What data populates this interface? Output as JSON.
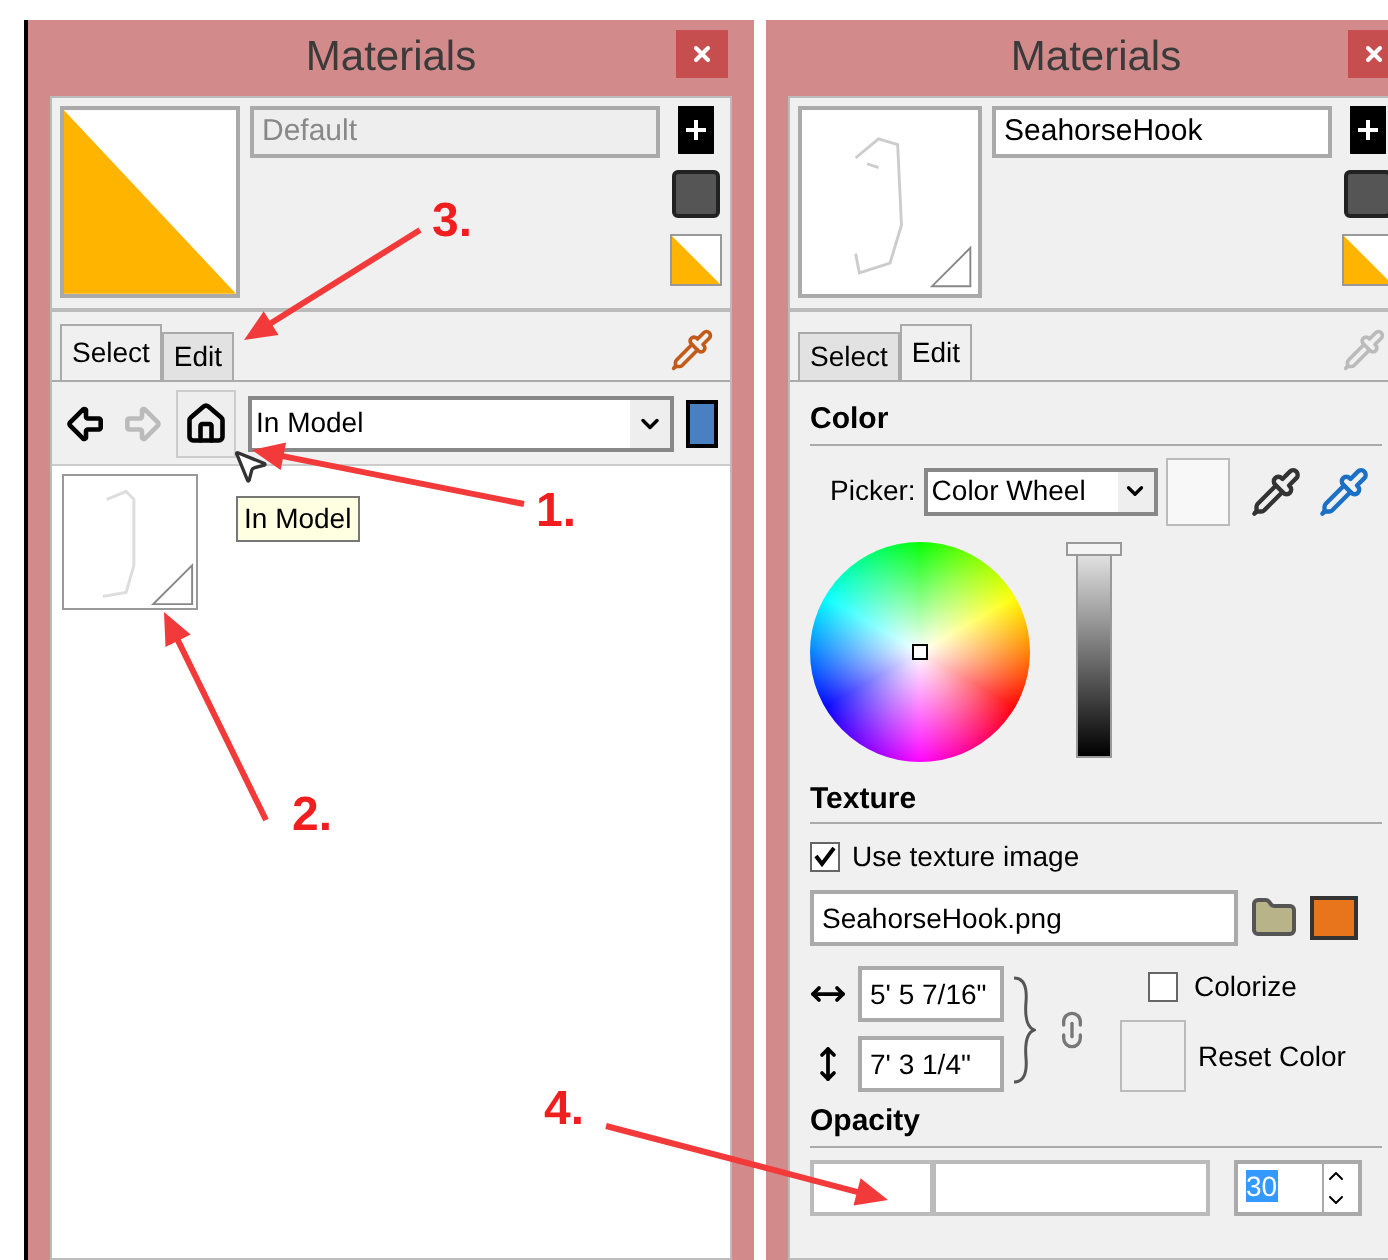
{
  "panels": [
    {
      "title": "Materials",
      "swatch": {
        "kind": "color",
        "color": "#ffb400"
      },
      "name": {
        "value": "Default",
        "disabled": true
      },
      "tabs": [
        {
          "label": "Select",
          "selected": true
        },
        {
          "label": "Edit",
          "selected": false
        }
      ],
      "eyedropper_enabled": true,
      "content": {
        "kind": "library",
        "collection": "In Model",
        "tooltip": "In Model"
      }
    },
    {
      "title": "Materials",
      "swatch": {
        "kind": "texture"
      },
      "name": {
        "value": "SeahorseHook",
        "disabled": false
      },
      "tabs": [
        {
          "label": "Select",
          "selected": false
        },
        {
          "label": "Edit",
          "selected": true
        }
      ],
      "eyedropper_enabled": false,
      "content": {
        "kind": "editor",
        "color": {
          "heading": "Color",
          "picker_label": "Picker:",
          "picker_value": "Color Wheel",
          "brightness": {
            "level": 1
          }
        },
        "texture": {
          "heading": "Texture",
          "use_texture": {
            "label": "Use texture image",
            "checked": true
          },
          "file": "SeahorseHook.png",
          "width": "5' 5 7/16\"",
          "height": "7' 3 1/4\"",
          "colorize": {
            "label": "Colorize",
            "checked": false
          },
          "reset_color": "Reset Color"
        },
        "opacity": {
          "heading": "Opacity",
          "level": 0.3,
          "value": "30"
        }
      }
    }
  ],
  "annotations": [
    {
      "label": "1."
    },
    {
      "label": "2."
    },
    {
      "label": "3."
    },
    {
      "label": "4."
    }
  ]
}
